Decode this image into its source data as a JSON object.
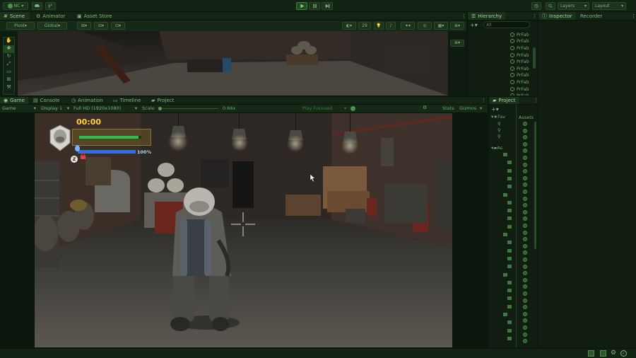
{
  "toolbar": {
    "account": "NC",
    "layers_label": "Layers",
    "layout_label": "Layout"
  },
  "scene_panel": {
    "tabs": [
      "Scene",
      "Animator",
      "Asset Store"
    ],
    "pivot_label": "Pivot",
    "global_label": "Global",
    "gizmo_count": "29"
  },
  "hierarchy_panel": {
    "tab": "Hierarchy",
    "search_placeholder": "All",
    "items": [
      "PrFab",
      "PrFab",
      "PrFab",
      "PrFab",
      "PrFab",
      "PrFab",
      "PrFab",
      "PrFab",
      "PrFab",
      "PrFab",
      "PrFab"
    ]
  },
  "inspector_panel": {
    "tabs": [
      "Inspector",
      "Recorder"
    ]
  },
  "game_panel": {
    "tabs": [
      "Game",
      "Console",
      "Animation",
      "Timeline",
      "Project"
    ],
    "mode": "Game",
    "display": "Display 1",
    "resolution": "Full HD (1920x1080)",
    "scale_label": "Scale",
    "scale_value": "0.66x",
    "play_focused": "Play Focused",
    "stats_label": "Stats",
    "gizmos_label": "Gizmos"
  },
  "hud": {
    "timer": "00:00",
    "health_fraction": 0.95,
    "energy_percent": "100%",
    "energy_fraction": 1.0,
    "key_hint": "Z"
  },
  "project_panel": {
    "tab": "Project",
    "assets_label": "Assets",
    "fav_label": "Fav",
    "assets_tree_label": "As"
  },
  "colors": {
    "accent": "#4fa34f",
    "health": "#2fbf4f",
    "energy": "#2f6fdf",
    "timer": "#ffd23a"
  }
}
